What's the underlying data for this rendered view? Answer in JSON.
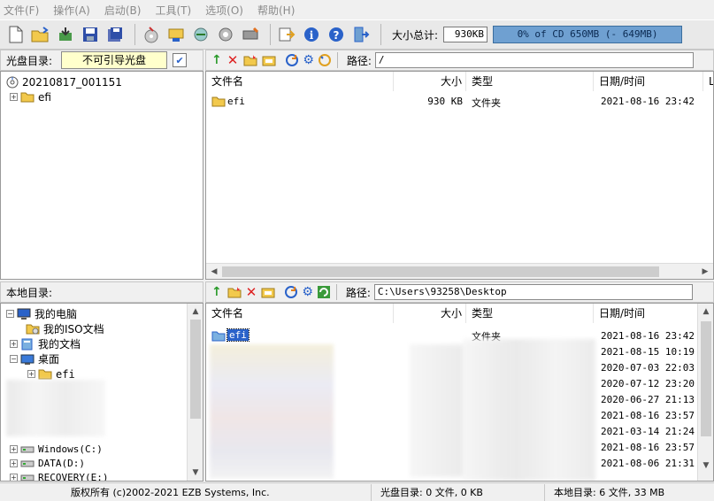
{
  "menu": [
    "文件(F)",
    "操作(A)",
    "启动(B)",
    "工具(T)",
    "选项(O)",
    "帮助(H)"
  ],
  "toolbar": {
    "size_label": "大小总计:",
    "size_value": "930KB",
    "progress_text": "0% of CD 650MB (- 649MB)",
    "progress_fraction": 0.0
  },
  "cd_pane": {
    "title": "光盘目录:",
    "boot_label": "不可引导光盘",
    "root": "20210817_001151",
    "folder": "efi"
  },
  "cd_list": {
    "path_label": "路径:",
    "path": "/",
    "columns": [
      "文件名",
      "大小",
      "类型",
      "日期/时间",
      "L"
    ],
    "rows": [
      {
        "name": "efi",
        "size": "930 KB",
        "type": "文件夹",
        "date": "2021-08-16 23:42"
      }
    ]
  },
  "local_pane": {
    "title": "本地目录:",
    "items": [
      "我的电脑",
      "我的ISO文档",
      "我的文档",
      "桌面",
      "efi",
      "Windows(C:)",
      "DATA(D:)",
      "RECOVERY(E:)"
    ]
  },
  "local_list": {
    "path_label": "路径:",
    "path": "C:\\Users\\93258\\Desktop",
    "columns": [
      "文件名",
      "大小",
      "类型",
      "日期/时间"
    ],
    "first_name": "efi",
    "first_type": "文件夹",
    "dates": [
      "2021-08-16 23:42",
      "2021-08-15 10:19",
      "2020-07-03 22:03",
      "2020-07-12 23:20",
      "2020-06-27 21:13",
      "2021-08-16 23:57",
      "2021-03-14 21:24",
      "2021-08-16 23:57",
      "2021-08-06 21:31"
    ]
  },
  "status": {
    "copyright": "版权所有 (c)2002-2021 EZB Systems, Inc.",
    "cd_info": "光盘目录: 0 文件, 0 KB",
    "local_info": "本地目录: 6 文件, 33 MB"
  },
  "colors": {
    "accent": "#2a62c9",
    "folder": "#f2c94c",
    "progress": "#6fa0d1"
  }
}
